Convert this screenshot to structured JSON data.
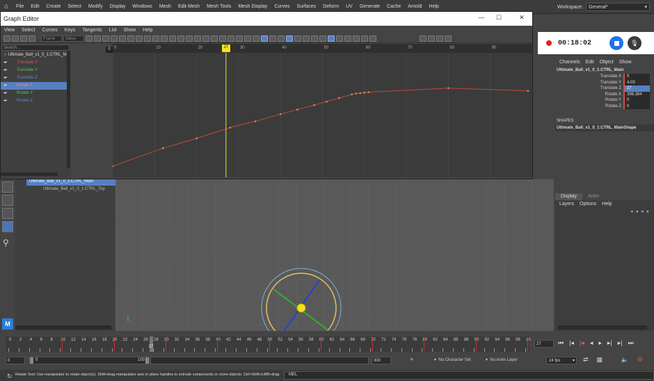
{
  "menubar": {
    "items": [
      "File",
      "Edit",
      "Create",
      "Select",
      "Modify",
      "Display",
      "Windows",
      "Mesh",
      "Edit Mesh",
      "Mesh Tools",
      "Mesh Display",
      "Curves",
      "Surfaces",
      "Deform",
      "UV",
      "Generate",
      "Cache",
      "Arnold",
      "Help"
    ],
    "workspace_label": "Workspace:",
    "workspace_value": "General*"
  },
  "graph_editor": {
    "title": "Graph Editor",
    "menu": [
      "View",
      "Select",
      "Curves",
      "Keys",
      "Tangents",
      "List",
      "Show",
      "Help"
    ],
    "frame_placeholder": "Frame",
    "value_placeholder": "Value",
    "search_placeholder": "Search...",
    "root_item": "Ultimate_Ball_v1_0_1:CTRL_Mai",
    "channels": [
      {
        "label": "Translate X",
        "color": "#d05a5a",
        "selected": false
      },
      {
        "label": "Translate Y",
        "color": "#5ac05a",
        "selected": false
      },
      {
        "label": "Translate Z",
        "color": "#5a8ad0",
        "selected": false
      },
      {
        "label": "Rotate X",
        "color": "#ff6a6a",
        "selected": true
      },
      {
        "label": "Rotate Y",
        "color": "#5ac05a",
        "selected": false
      },
      {
        "label": "Rotate Z",
        "color": "#5a8ad0",
        "selected": false
      }
    ],
    "ruler_ticks": [
      "0",
      "10",
      "20",
      "30",
      "40",
      "50",
      "60",
      "70",
      "80",
      "90"
    ],
    "current_frame": "27",
    "curve_keys": [
      {
        "frame": 0,
        "value": 0
      },
      {
        "frame": 12,
        "value": 0.2
      },
      {
        "frame": 20,
        "value": 0.31
      },
      {
        "frame": 28,
        "value": 0.43
      },
      {
        "frame": 34,
        "value": 0.5
      },
      {
        "frame": 40,
        "value": 0.58
      },
      {
        "frame": 44,
        "value": 0.63
      },
      {
        "frame": 48,
        "value": 0.68
      },
      {
        "frame": 51,
        "value": 0.72
      },
      {
        "frame": 54,
        "value": 0.76
      },
      {
        "frame": 57,
        "value": 0.8
      },
      {
        "frame": 58,
        "value": 0.81
      },
      {
        "frame": 59,
        "value": 0.815
      },
      {
        "frame": 60,
        "value": 0.82
      },
      {
        "frame": 61,
        "value": 0.825
      },
      {
        "frame": 80,
        "value": 0.87
      },
      {
        "frame": 99,
        "value": 0.84
      }
    ]
  },
  "outliner": {
    "items": [
      "Ultimate_Ball_v1_0_1:CTRL_Main",
      "Ultimate_Ball_v1_0_1:CTRL_Top"
    ]
  },
  "recorder": {
    "time": "00:18:02"
  },
  "channel_box": {
    "menu": [
      "Channels",
      "Edit",
      "Object",
      "Show"
    ],
    "object": "Ultimate_Ball_v1_0_1:CTRL_Main",
    "attrs": [
      {
        "label": "Translate X",
        "value": "0",
        "selected": false
      },
      {
        "label": "Translate Y",
        "value": "4.09",
        "selected": false
      },
      {
        "label": "Translate Z",
        "value": "27",
        "selected": true
      },
      {
        "label": "Rotate X",
        "value": "396.384",
        "selected": false
      },
      {
        "label": "Rotate Y",
        "value": "0",
        "selected": false
      },
      {
        "label": "Rotate Z",
        "value": "0",
        "selected": false
      }
    ],
    "shapes_header": "SHAPES",
    "shape_name": "Ultimate_Ball_v1_0_1:CTRL_MainShape"
  },
  "layer_editor": {
    "tabs": [
      "Display",
      "Anim"
    ],
    "menu": [
      "Layers",
      "Options",
      "Help"
    ]
  },
  "timeline": {
    "ticks": [
      "0",
      "2",
      "4",
      "6",
      "8",
      "10",
      "12",
      "14",
      "16",
      "18",
      "20",
      "22",
      "24",
      "26",
      "28",
      "30",
      "32",
      "34",
      "36",
      "38",
      "40",
      "42",
      "44",
      "46",
      "48",
      "50",
      "52",
      "54",
      "56",
      "58",
      "60",
      "62",
      "64",
      "66",
      "68",
      "70",
      "72",
      "74",
      "76",
      "78",
      "80",
      "82",
      "84",
      "86",
      "88",
      "90",
      "92",
      "94",
      "96",
      "98",
      "10"
    ],
    "current": "27",
    "frame_field": "27"
  },
  "range": {
    "start": "0",
    "inner_start": "0",
    "inner_end": "100",
    "end": "300",
    "character_set": "No Character Set",
    "anim_layer": "No Anim Layer",
    "fps": "24 fps"
  },
  "status": {
    "message": "Rotate Tool: Use manipulator to rotate object(s). Shift+drag manipulator axis or plane handles to extrude components or clone objects. Ctrl+Shift+LMB+drag b",
    "mel": "MEL"
  }
}
